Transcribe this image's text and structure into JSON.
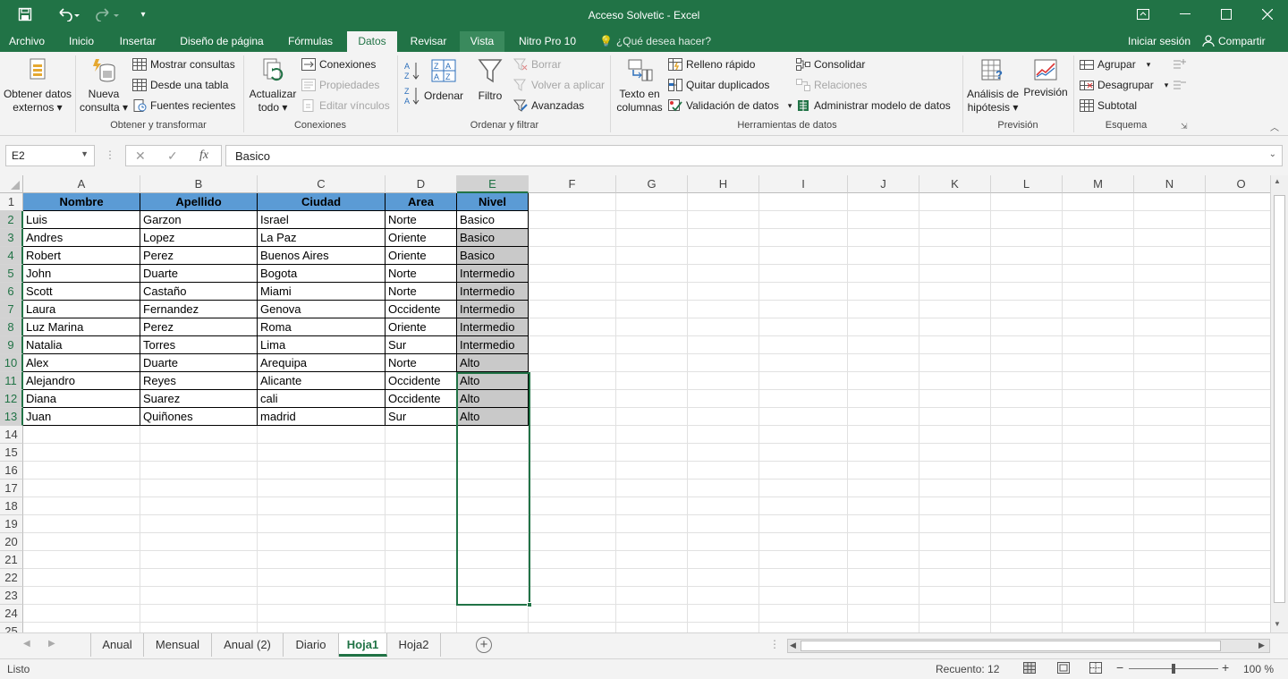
{
  "title": "Acceso Solvetic - Excel",
  "menu": {
    "archivo": "Archivo",
    "inicio": "Inicio",
    "insertar": "Insertar",
    "diseno": "Diseño de página",
    "formulas": "Fórmulas",
    "datos": "Datos",
    "revisar": "Revisar",
    "vista": "Vista",
    "nitro": "Nitro Pro 10",
    "tell_me": "¿Qué desea hacer?",
    "iniciar": "Iniciar sesión",
    "compartir": "Compartir"
  },
  "ribbon": {
    "obtener1": "Obtener datos",
    "obtener2": "externos",
    "nueva1": "Nueva",
    "nueva2": "consulta",
    "mostrar": "Mostrar consultas",
    "desde": "Desde una tabla",
    "fuentes": "Fuentes recientes",
    "g1": "Obtener y transformar",
    "actualizar1": "Actualizar",
    "actualizar2": "todo",
    "conexiones": "Conexiones",
    "propiedades": "Propiedades",
    "editar": "Editar vínculos",
    "g2": "Conexiones",
    "ordenar": "Ordenar",
    "filtro": "Filtro",
    "borrar": "Borrar",
    "volver": "Volver a aplicar",
    "avanzadas": "Avanzadas",
    "g3": "Ordenar y filtrar",
    "texto1": "Texto en",
    "texto2": "columnas",
    "relleno": "Relleno rápido",
    "quitar": "Quitar duplicados",
    "validacion": "Validación de datos",
    "consolidar": "Consolidar",
    "relaciones": "Relaciones",
    "administrar": "Administrar modelo de datos",
    "g4": "Herramientas de datos",
    "analisis1": "Análisis de",
    "analisis2": "hipótesis",
    "prevision": "Previsión",
    "g5": "Previsión",
    "agrupar": "Agrupar",
    "desagrupar": "Desagrupar",
    "subtotal": "Subtotal",
    "g6": "Esquema"
  },
  "formula": {
    "namebox": "E2",
    "content": "Basico"
  },
  "columns": [
    "A",
    "B",
    "C",
    "D",
    "E",
    "F",
    "G",
    "H",
    "I",
    "J",
    "K",
    "L",
    "M",
    "N",
    "O"
  ],
  "rows": [
    "1",
    "2",
    "3",
    "4",
    "5",
    "6",
    "7",
    "8",
    "9",
    "10",
    "11",
    "12",
    "13",
    "14",
    "15",
    "16",
    "17",
    "18",
    "19",
    "20",
    "21",
    "22",
    "23",
    "24",
    "25"
  ],
  "table": {
    "headers": [
      "Nombre",
      "Apellido",
      "Ciudad",
      "Area",
      "Nivel"
    ],
    "rows": [
      [
        "Luis",
        "Garzon",
        "Israel",
        "Norte",
        "Basico"
      ],
      [
        "Andres",
        "Lopez",
        "La Paz",
        "Oriente",
        "Basico"
      ],
      [
        "Robert",
        "Perez",
        "Buenos Aires",
        "Oriente",
        "Basico"
      ],
      [
        "John",
        "Duarte",
        "Bogota",
        "Norte",
        "Intermedio"
      ],
      [
        "Scott",
        "Castaño",
        "Miami",
        "Norte",
        "Intermedio"
      ],
      [
        "Laura",
        "Fernandez",
        "Genova",
        "Occidente",
        "Intermedio"
      ],
      [
        "Luz Marina",
        "Perez",
        "Roma",
        "Oriente",
        "Intermedio"
      ],
      [
        "Natalia",
        "Torres",
        "Lima",
        "Sur",
        "Intermedio"
      ],
      [
        "Alex",
        "Duarte",
        "Arequipa",
        "Norte",
        "Alto"
      ],
      [
        "Alejandro",
        "Reyes",
        "Alicante",
        "Occidente",
        "Alto"
      ],
      [
        "Diana",
        "Suarez",
        "cali",
        "Occidente",
        "Alto"
      ],
      [
        "Juan",
        "Quiñones",
        "madrid",
        "Sur",
        "Alto"
      ]
    ]
  },
  "sheets": [
    "Anual",
    "Mensual",
    "Anual (2)",
    "Diario",
    "Hoja1",
    "Hoja2"
  ],
  "active_sheet": "Hoja1",
  "status": {
    "listo": "Listo",
    "recuento": "Recuento: 12",
    "zoom": "100 %"
  },
  "colors": {
    "excel_green": "#217346",
    "header_fill": "#5b9bd5",
    "selected_fill": "#c9c9c9"
  }
}
